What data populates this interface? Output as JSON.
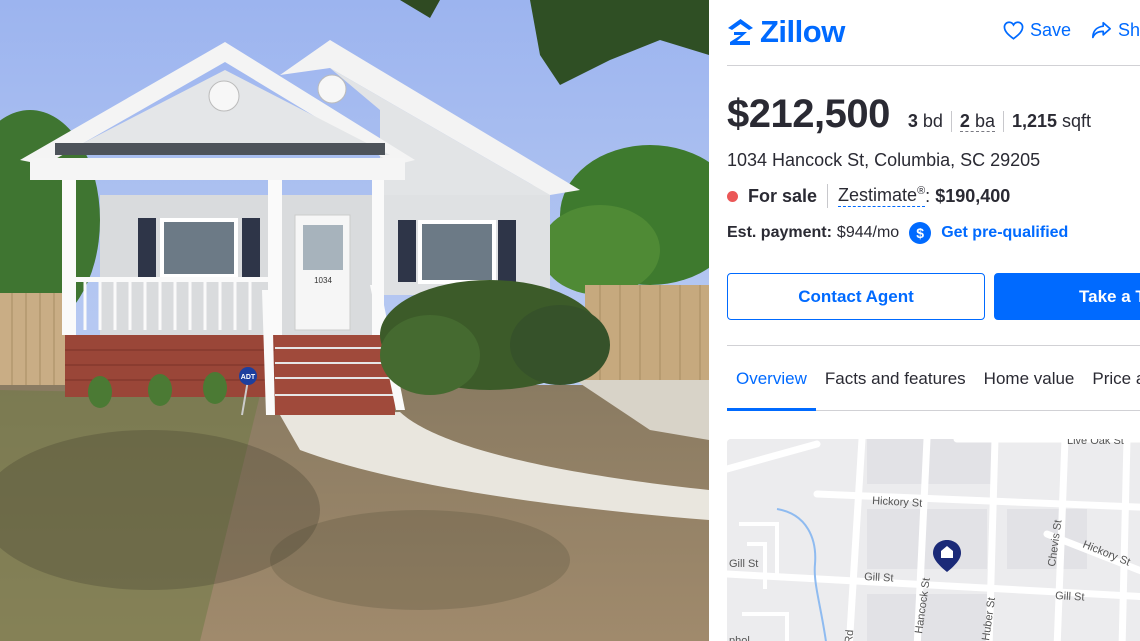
{
  "header": {
    "logo_text": "Zillow",
    "save_label": "Save",
    "share_label": "Share"
  },
  "listing": {
    "price": "$212,500",
    "beds_num": "3",
    "beds_unit": "bd",
    "baths_num": "2",
    "baths_unit": "ba",
    "sqft_num": "1,215",
    "sqft_unit": "sqft",
    "address": "1034 Hancock St, Columbia, SC 29205",
    "status": "For sale",
    "zestimate_label": "Zestimate",
    "zestimate_mark": "®",
    "zestimate_colon": ":",
    "zestimate_value": "$190,400",
    "payment_label": "Est. payment:",
    "payment_value": "$944/mo",
    "payment_badge": "$",
    "prequal_label": "Get pre-qualified",
    "house_number": "1034",
    "sign_text": "ADT"
  },
  "buttons": {
    "contact": "Contact Agent",
    "tour": "Take a Tour"
  },
  "tabs": [
    {
      "label": "Overview"
    },
    {
      "label": "Facts and features"
    },
    {
      "label": "Home value"
    },
    {
      "label": "Price and tax history"
    }
  ],
  "map": {
    "streets": {
      "live_oak": "Live Oak St",
      "hickory1": "Hickory St",
      "hickory2": "Hickory St",
      "gill1": "Gill St",
      "gill2": "Gill St",
      "gill3": "Gill St",
      "hancock": "Hancock St",
      "chevis": "Chevis St",
      "huber": "Huber St",
      "rd": "Rd",
      "edge": "phol"
    }
  },
  "colors": {
    "brand": "#006aff",
    "status_dot": "#eb5757"
  },
  "icons": [
    "zillow-logo-icon",
    "heart-icon",
    "share-icon",
    "dollar-icon",
    "home-pin-icon"
  ]
}
